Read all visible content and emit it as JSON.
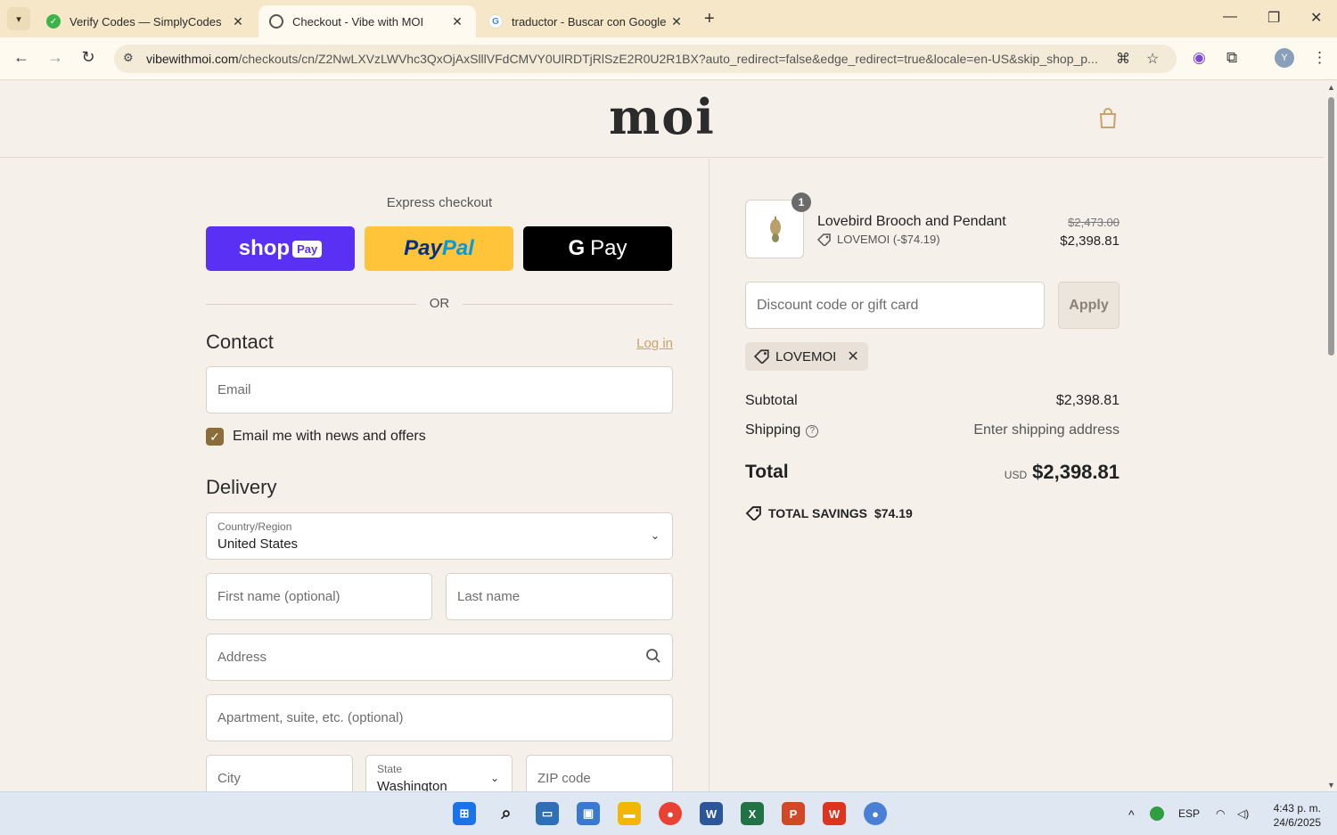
{
  "browser": {
    "tabs": [
      {
        "title": "Verify Codes — SimplyCodes"
      },
      {
        "title": "Checkout - Vibe with MOI"
      },
      {
        "title": "traductor - Buscar con Google"
      }
    ],
    "url_host": "vibewithmoi.com",
    "url_path": "/checkouts/cn/Z2NwLXVzLWVhc3QxOjAxSlllVFdCMVY0UlRDTjRlSzE2R0U2R1BX?auto_redirect=false&edge_redirect=true&locale=en-US&skip_shop_p..."
  },
  "site": {
    "logo": "moi"
  },
  "express": {
    "title": "Express checkout",
    "shop_pay": "shop",
    "shop_pay_badge": "Pay",
    "paypal_1": "Pay",
    "paypal_2": "Pal",
    "gpay_g": "G",
    "gpay": "Pay",
    "or": "OR"
  },
  "contact": {
    "heading": "Contact",
    "login": "Log in",
    "email_placeholder": "Email",
    "newsletter_label": "Email me with news and offers",
    "newsletter_checked": true
  },
  "delivery": {
    "heading": "Delivery",
    "country_label": "Country/Region",
    "country_value": "United States",
    "first_name_placeholder": "First name (optional)",
    "last_name_placeholder": "Last name",
    "address_placeholder": "Address",
    "apartment_placeholder": "Apartment, suite, etc. (optional)",
    "city_placeholder": "City",
    "state_label": "State",
    "state_value": "Washington",
    "zip_placeholder": "ZIP code"
  },
  "summary": {
    "qty": "1",
    "product_name": "Lovebird Brooch and Pendant",
    "product_discount": "LOVEMOI (-$74.19)",
    "price_original": "$2,473.00",
    "price_final": "$2,398.81",
    "discount_placeholder": "Discount code or gift card",
    "apply": "Apply",
    "applied_code": "LOVEMOI",
    "subtotal_label": "Subtotal",
    "subtotal_value": "$2,398.81",
    "shipping_label": "Shipping",
    "shipping_value": "Enter shipping address",
    "total_label": "Total",
    "currency": "USD",
    "total_value": "$2,398.81",
    "savings_label": "TOTAL SAVINGS",
    "savings_value": "$74.19"
  },
  "taskbar": {
    "language": "ESP",
    "time": "4:43 p. m.",
    "date": "24/6/2025"
  },
  "colors": {
    "shop_pay": "#5a31f4",
    "paypal": "#ffc439",
    "gpay": "#000000",
    "page_bg": "#f6f0ea",
    "accent_link": "#c9a36a"
  }
}
